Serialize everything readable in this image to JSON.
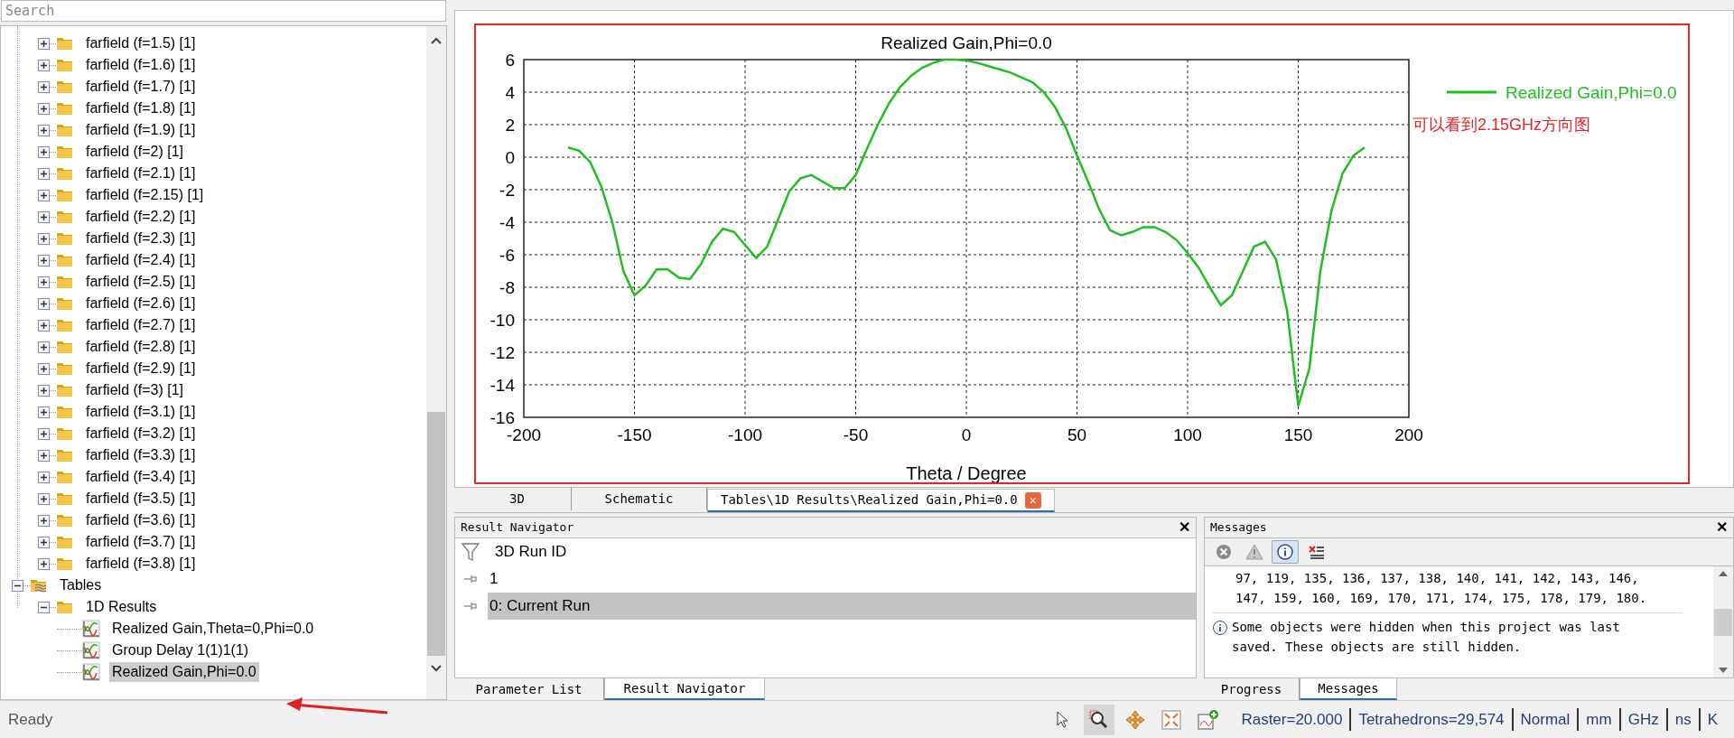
{
  "search": {
    "placeholder": "Search"
  },
  "tree": {
    "farfield_items": [
      {
        "label": "farfield (f=1.5) [1]",
        "kind": "folder",
        "expanded": false
      },
      {
        "label": "farfield (f=1.6) [1]",
        "kind": "folder",
        "expanded": false
      },
      {
        "label": "farfield (f=1.7) [1]",
        "kind": "folder",
        "expanded": false
      },
      {
        "label": "farfield (f=1.8) [1]",
        "kind": "folder",
        "expanded": false
      },
      {
        "label": "farfield (f=1.9) [1]",
        "kind": "folder",
        "expanded": false
      },
      {
        "label": "farfield (f=2) [1]",
        "kind": "folder",
        "expanded": false
      },
      {
        "label": "farfield (f=2.1) [1]",
        "kind": "folder",
        "expanded": false
      },
      {
        "label": "farfield (f=2.15) [1]",
        "kind": "folder",
        "expanded": false
      },
      {
        "label": "farfield (f=2.2) [1]",
        "kind": "folder",
        "expanded": false
      },
      {
        "label": "farfield (f=2.3) [1]",
        "kind": "folder",
        "expanded": false
      },
      {
        "label": "farfield (f=2.4) [1]",
        "kind": "folder",
        "expanded": false
      },
      {
        "label": "farfield (f=2.5) [1]",
        "kind": "folder",
        "expanded": false
      },
      {
        "label": "farfield (f=2.6) [1]",
        "kind": "folder",
        "expanded": false
      },
      {
        "label": "farfield (f=2.7) [1]",
        "kind": "folder",
        "expanded": false
      },
      {
        "label": "farfield (f=2.8) [1]",
        "kind": "folder",
        "expanded": false
      },
      {
        "label": "farfield (f=2.9) [1]",
        "kind": "folder",
        "expanded": false
      },
      {
        "label": "farfield (f=3) [1]",
        "kind": "folder",
        "expanded": false
      },
      {
        "label": "farfield (f=3.1) [1]",
        "kind": "folder",
        "expanded": false
      },
      {
        "label": "farfield (f=3.2) [1]",
        "kind": "folder",
        "expanded": false
      },
      {
        "label": "farfield (f=3.3) [1]",
        "kind": "folder",
        "expanded": false
      },
      {
        "label": "farfield (f=3.4) [1]",
        "kind": "folder",
        "expanded": false
      },
      {
        "label": "farfield (f=3.5) [1]",
        "kind": "folder",
        "expanded": false
      },
      {
        "label": "farfield (f=3.6) [1]",
        "kind": "folder",
        "expanded": false
      },
      {
        "label": "farfield (f=3.7) [1]",
        "kind": "folder",
        "expanded": false
      },
      {
        "label": "farfield (f=3.8) [1]",
        "kind": "folder",
        "expanded": false
      }
    ],
    "items": [
      {
        "label": "Tables",
        "kind": "tables",
        "expanded": true,
        "children": [
          {
            "label": "1D Results",
            "kind": "folder",
            "expanded": true,
            "children": [
              {
                "label": "Realized Gain,Theta=0,Phi=0.0",
                "kind": "result",
                "selected": false
              },
              {
                "label": "Group Delay 1(1)1(1)",
                "kind": "result",
                "selected": false
              },
              {
                "label": "Realized Gain,Phi=0.0",
                "kind": "result",
                "selected": true
              }
            ]
          }
        ]
      }
    ]
  },
  "plot": {
    "chart_data": {
      "type": "line",
      "title": "Realized Gain,Phi=0.0",
      "xlabel": "Theta / Degree",
      "x": [
        -180,
        -175,
        -170,
        -165,
        -160,
        -155,
        -150,
        -145,
        -140,
        -135,
        -130,
        -125,
        -120,
        -115,
        -110,
        -105,
        -100,
        -95,
        -90,
        -85,
        -80,
        -75,
        -70,
        -65,
        -60,
        -55,
        -50,
        -45,
        -40,
        -35,
        -30,
        -25,
        -20,
        -15,
        -10,
        -5,
        0,
        5,
        10,
        15,
        20,
        25,
        30,
        35,
        40,
        45,
        50,
        55,
        60,
        65,
        70,
        75,
        80,
        85,
        90,
        95,
        100,
        105,
        110,
        115,
        120,
        125,
        130,
        135,
        140,
        145,
        150,
        155,
        160,
        165,
        170,
        175,
        180
      ],
      "series": [
        {
          "name": "Realized Gain,Phi=0.0",
          "color": "#1fbf1f",
          "values": [
            0.6,
            0.4,
            -0.3,
            -1.8,
            -4,
            -7,
            -8.5,
            -7.9,
            -6.9,
            -6.9,
            -7.4,
            -7.5,
            -6.6,
            -5.2,
            -4.4,
            -4.6,
            -5.4,
            -6.2,
            -5.5,
            -3.8,
            -2.1,
            -1.3,
            -1.1,
            -1.5,
            -1.9,
            -1.9,
            -1.1,
            0.5,
            2,
            3.3,
            4.3,
            5,
            5.5,
            5.8,
            6,
            6,
            5.95,
            5.8,
            5.6,
            5.4,
            5.2,
            4.9,
            4.6,
            4,
            3.1,
            1.8,
            0.1,
            -1.5,
            -3.2,
            -4.5,
            -4.8,
            -4.6,
            -4.3,
            -4.3,
            -4.6,
            -5.1,
            -5.9,
            -6.8,
            -8,
            -9.1,
            -8.5,
            -7,
            -5.5,
            -5.2,
            -6.3,
            -9.5,
            -15.3,
            -13,
            -7,
            -3.3,
            -1,
            0.1,
            0.6
          ]
        }
      ],
      "xlim": [
        -200,
        200
      ],
      "ylim": [
        -16,
        6
      ],
      "xticks": [
        -200,
        -150,
        -100,
        -50,
        0,
        50,
        100,
        150,
        200
      ],
      "yticks": [
        -16,
        -14,
        -12,
        -10,
        -8,
        -6,
        -4,
        -2,
        0,
        2,
        4,
        6
      ],
      "grid": true,
      "annotations": [
        "可以看到2.15GHz方向图"
      ]
    }
  },
  "view_tabs": [
    {
      "label": "3D",
      "selected": false
    },
    {
      "label": "Schematic",
      "selected": false
    },
    {
      "label": "Tables\\1D Results\\Realized Gain,Phi=0.0",
      "selected": true,
      "close": "✕"
    }
  ],
  "result_navigator": {
    "title": "Result Navigator",
    "close": "✕",
    "filter_label": "3D Run ID",
    "runs": [
      {
        "label": "1",
        "selected": false
      },
      {
        "label": "0: Current Run",
        "selected": true
      }
    ],
    "tabs": [
      {
        "label": "Parameter List",
        "selected": false
      },
      {
        "label": "Result Navigator",
        "selected": true
      }
    ]
  },
  "messages": {
    "title": "Messages",
    "close": "✕",
    "toolbar": [
      {
        "kind": "error",
        "selected": false
      },
      {
        "kind": "warning",
        "selected": false
      },
      {
        "kind": "info",
        "selected": true
      },
      {
        "kind": "clear",
        "selected": false
      }
    ],
    "entries": [
      {
        "kind": "text",
        "text": "97, 119, 135, 136, 137, 138, 140, 141, 142, 143, 146,"
      },
      {
        "kind": "text",
        "text": "147, 159, 160, 169, 170, 171, 174, 175, 178, 179, 180."
      },
      {
        "kind": "info",
        "text": "Some objects were hidden when this project was last saved. These objects are still hidden."
      }
    ],
    "tabs": [
      {
        "label": "Progress",
        "selected": false
      },
      {
        "label": "Messages",
        "selected": true
      }
    ]
  },
  "status_bar": {
    "text": "Ready",
    "tools": [
      {
        "kind": "pointer",
        "selected": false
      },
      {
        "kind": "zoom",
        "selected": true
      },
      {
        "kind": "pan",
        "selected": false
      },
      {
        "kind": "fit",
        "selected": false
      },
      {
        "kind": "add-plot",
        "selected": false
      }
    ],
    "fields": [
      "Raster=20.000",
      "Tetrahedrons=29,574",
      "Normal",
      "mm",
      "GHz",
      "ns",
      "K"
    ]
  }
}
